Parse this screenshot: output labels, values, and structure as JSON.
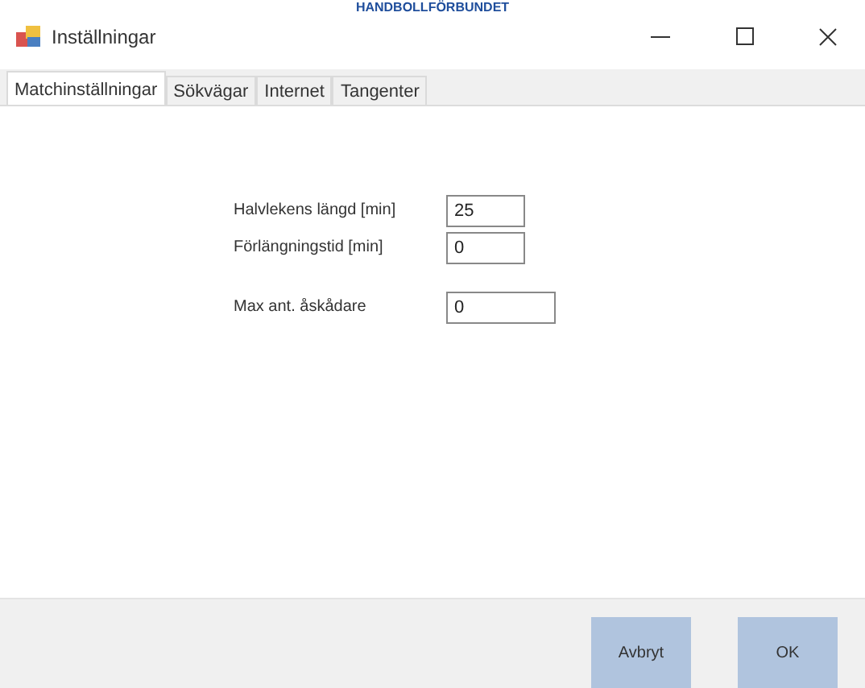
{
  "banner": "HANDBOLLFÖRBUNDET",
  "window": {
    "title": "Inställningar"
  },
  "tabs": [
    {
      "label": "Matchinställningar",
      "selected": true
    },
    {
      "label": "Sökvägar",
      "selected": false
    },
    {
      "label": "Internet",
      "selected": false
    },
    {
      "label": "Tangenter",
      "selected": false
    }
  ],
  "fields": [
    {
      "label": "Halvlekens längd [min]",
      "value": "25"
    },
    {
      "label": "Förlängningstid [min]",
      "value": "0"
    },
    {
      "label": "Max ant. åskådare",
      "value": "0"
    }
  ],
  "buttons": [
    "Avbryt",
    "OK"
  ]
}
